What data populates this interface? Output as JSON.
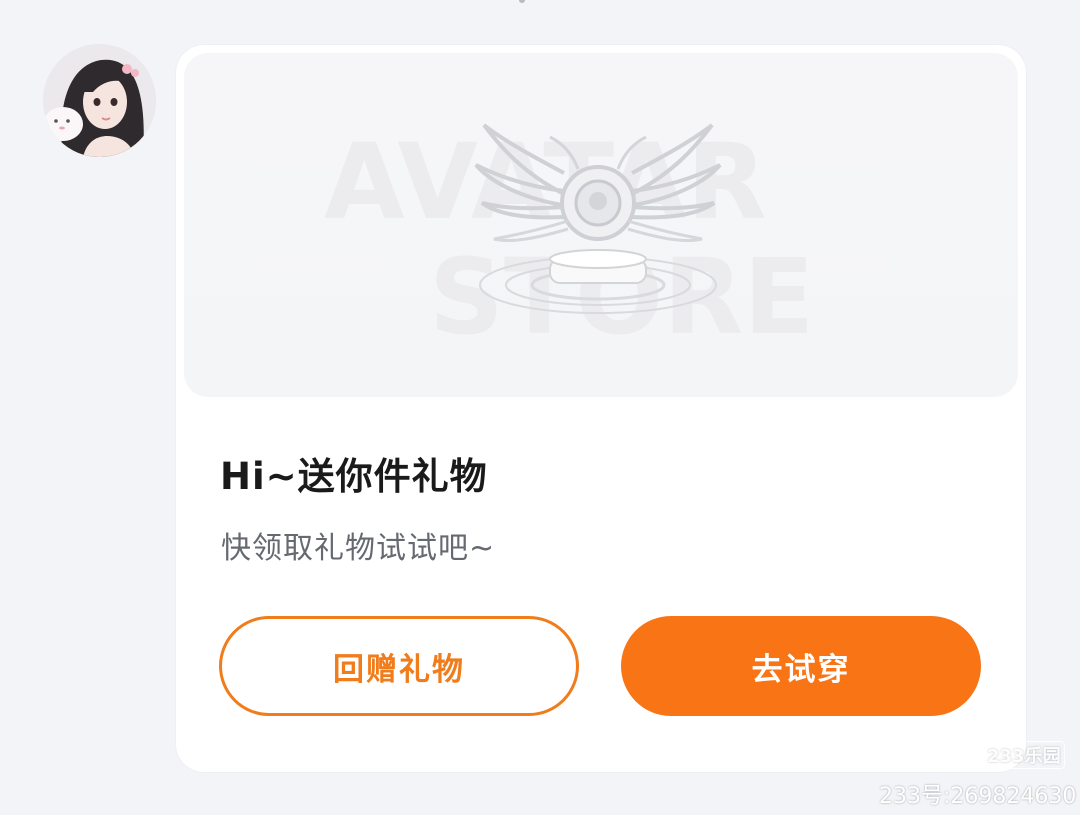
{
  "sender": {
    "avatar_icon": "user-avatar"
  },
  "gift_card": {
    "banner": {
      "watermark_line1": "AVATAR",
      "watermark_line2": "STORE",
      "emblem_icon": "winged-orb-pedestal"
    },
    "title": "Hi~送你件礼物",
    "subtitle": "快领取礼物试试吧~",
    "buttons": {
      "return_gift": "回赠礼物",
      "try_on": "去试穿"
    },
    "colors": {
      "accent": "#f97414",
      "outline": "#f07c1b",
      "title": "#1a1a1a",
      "subtitle": "#666a70"
    }
  },
  "watermark": {
    "logo": "233乐园",
    "text": "233号:269824630"
  }
}
